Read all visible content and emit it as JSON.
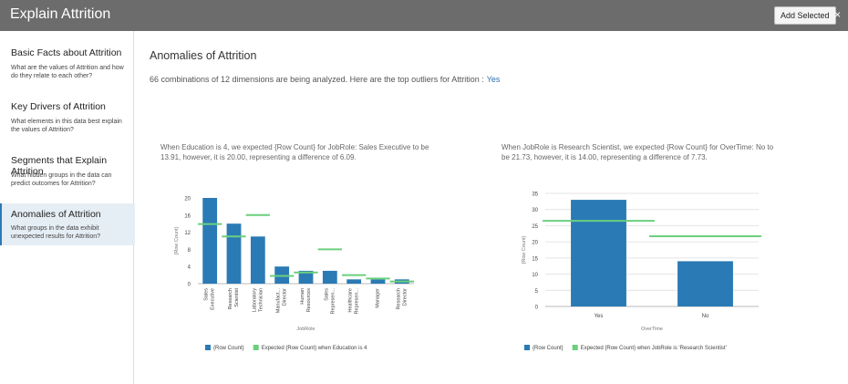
{
  "header": {
    "title": "Explain Attrition",
    "add_label": "Add Selected",
    "close_label": "×"
  },
  "sidebar": {
    "items": [
      {
        "label": "Basic Facts about Attrition",
        "desc": "What are the values of Attrition and how do they relate to each other?"
      },
      {
        "label": "Key Drivers of Attrition",
        "desc": "What elements in this data best explain the values of Attrition?"
      },
      {
        "label": "Segments that Explain Attrition",
        "desc": "What hidden groups in the data can predict outcomes for Attrition?"
      },
      {
        "label": "Anomalies of Attrition",
        "desc": "What groups in the data exhibit unexpected results for Attrition?"
      }
    ]
  },
  "main": {
    "title": "Anomalies of Attrition",
    "subtitle": "66 combinations of 12 dimensions are being analyzed. Here are the top outliers for Attrition :",
    "subtitle_value": "Yes"
  },
  "chart_notes": [
    "When Education is 4, we expected {Row Count} for JobRole: Sales Executive to be 13.91, however, it is 20.00, representing a difference of 6.09.",
    "When JobRole is Research Scientist, we expected {Row Count} for OverTime: No to be 21.73, however, it is 14.00, representing a difference of 7.73."
  ],
  "colors": {
    "bar": "#2a7ab5",
    "expected": "#6ccf7e",
    "grid": "#e4e4e4"
  },
  "chart_data": [
    {
      "type": "bar",
      "categories": [
        "Sales Executive",
        "Research Scientist",
        "Laboratory Technician",
        "Manufact... Director",
        "Human Resources",
        "Sales Represen...",
        "Healthcare Represen...",
        "Manager",
        "Research Director"
      ],
      "category_lines": [
        [
          "Sales",
          "Executive"
        ],
        [
          "Research",
          "Scientist"
        ],
        [
          "Laboratory",
          "Technician"
        ],
        [
          "Manufact...",
          "Director"
        ],
        [
          "Human",
          "Resources"
        ],
        [
          "Sales",
          "Represen..."
        ],
        [
          "Healthcare",
          "Represen..."
        ],
        [
          "Manager"
        ],
        [
          "Research",
          "Director"
        ]
      ],
      "series": [
        {
          "name": "{Row Count}",
          "values": [
            20,
            14,
            11,
            4,
            3,
            3,
            1,
            1,
            1
          ]
        },
        {
          "name": "Expected {Row Count} when Education is 4",
          "values": [
            13.91,
            11,
            16,
            1.8,
            2.6,
            8,
            2,
            1.2,
            0.5
          ]
        }
      ],
      "xlabel": "JobRole",
      "ylabel": "{Row Count}",
      "ylim": [
        0,
        20
      ],
      "yticks": [
        0,
        4,
        8,
        12,
        16,
        20
      ],
      "grid": false
    },
    {
      "type": "bar",
      "categories": [
        "Yes",
        "No"
      ],
      "category_lines": [
        [
          "Yes"
        ],
        [
          "No"
        ]
      ],
      "series": [
        {
          "name": "{Row Count}",
          "values": [
            33,
            14
          ]
        },
        {
          "name": "Expected {Row Count} when JobRole is 'Research Scientist'",
          "values": [
            26.5,
            21.73
          ]
        }
      ],
      "xlabel": "OverTime",
      "ylabel": "{Row Count}",
      "ylim": [
        0,
        35
      ],
      "yticks": [
        0,
        5,
        10,
        15,
        20,
        25,
        30,
        35
      ],
      "grid": true
    }
  ]
}
